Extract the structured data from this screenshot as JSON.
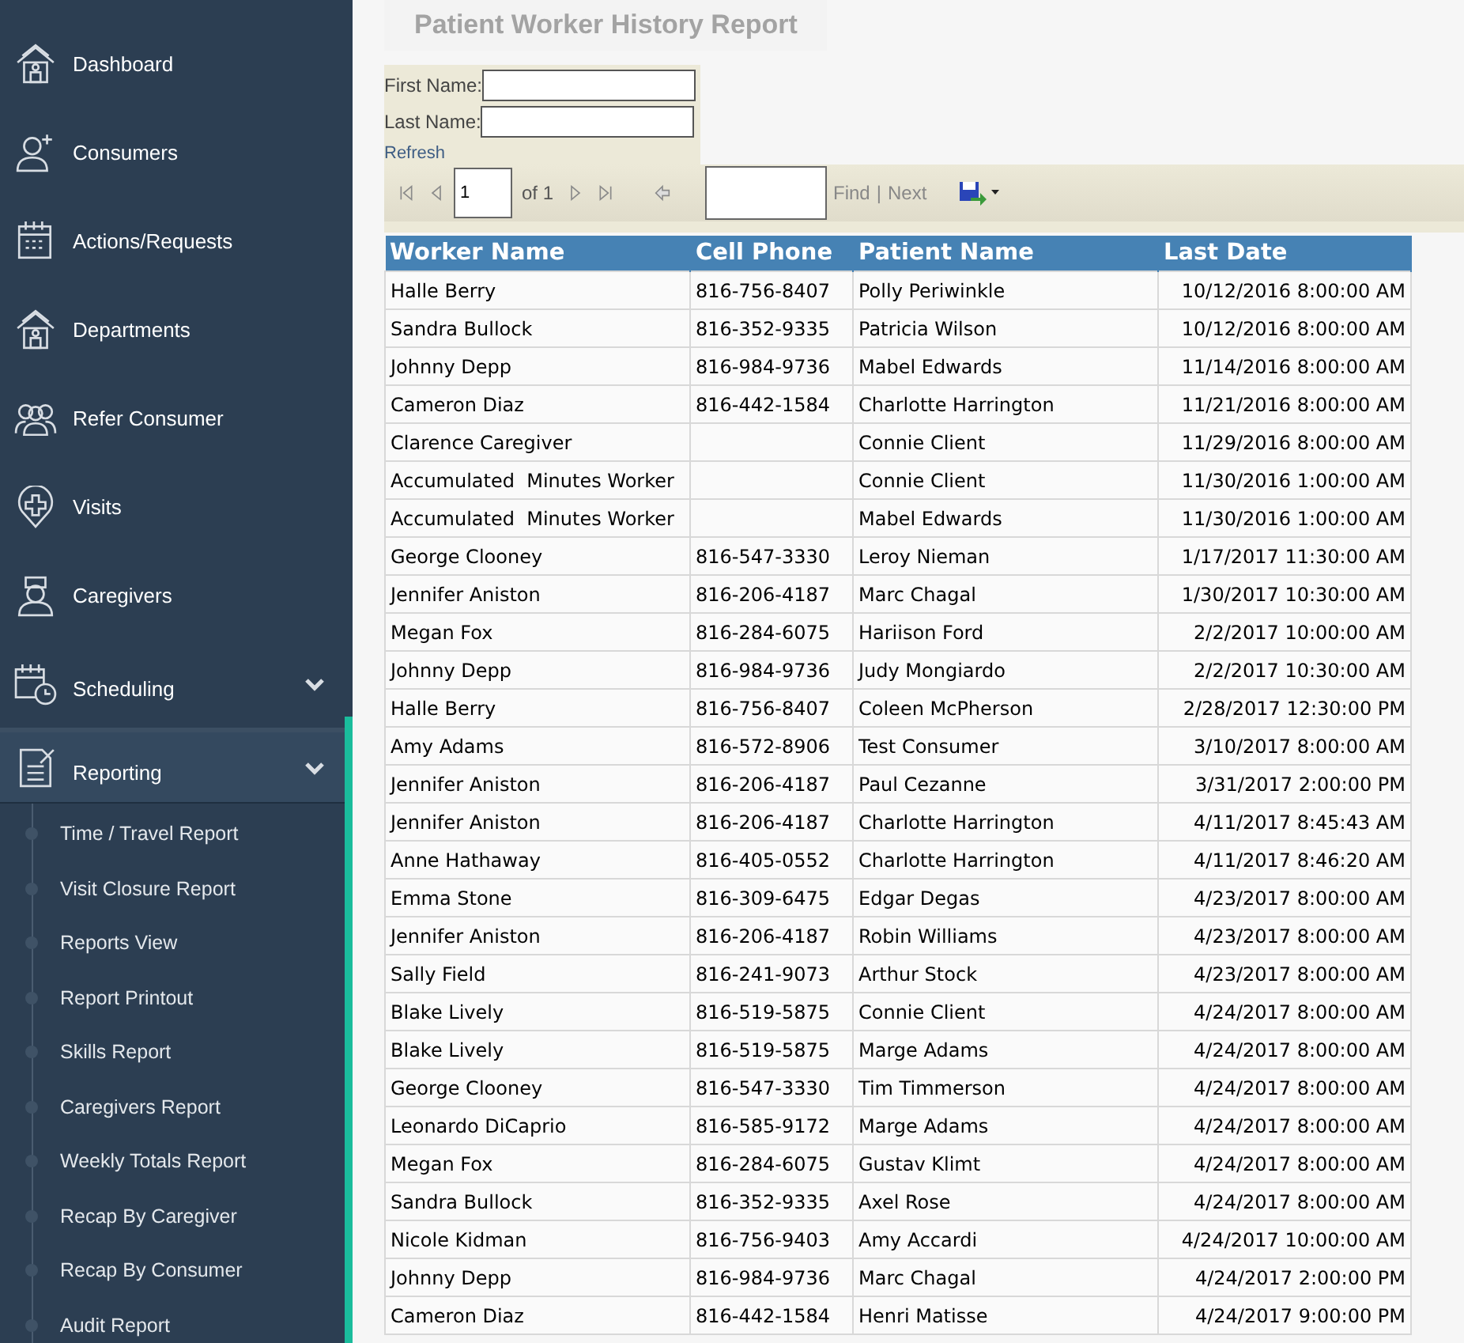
{
  "sidebar": {
    "items": [
      {
        "label": "Dashboard",
        "kind": "link"
      },
      {
        "label": "Consumers",
        "kind": "link"
      },
      {
        "label": "Actions/Requests",
        "kind": "link"
      },
      {
        "label": "Departments",
        "kind": "link"
      },
      {
        "label": "Refer Consumer",
        "kind": "link"
      },
      {
        "label": "Visits",
        "kind": "link"
      },
      {
        "label": "Caregivers",
        "kind": "link"
      },
      {
        "label": "Scheduling",
        "kind": "group",
        "expanded": false
      },
      {
        "label": "Reporting",
        "kind": "group",
        "expanded": true,
        "children": [
          {
            "label": "Time / Travel Report"
          },
          {
            "label": "Visit Closure Report"
          },
          {
            "label": "Reports View"
          },
          {
            "label": "Report Printout"
          },
          {
            "label": "Skills Report"
          },
          {
            "label": "Caregivers Report"
          },
          {
            "label": "Weekly Totals Report"
          },
          {
            "label": "Recap By Caregiver"
          },
          {
            "label": "Recap By Consumer"
          },
          {
            "label": "Audit Report"
          }
        ]
      }
    ]
  },
  "report": {
    "title": "Patient Worker History Report",
    "parameters": [
      {
        "label": "First Name:"
      },
      {
        "label": "Last Name:"
      }
    ],
    "refresh": "Refresh",
    "toolbar": {
      "page": "1",
      "of": "of 1",
      "find": "Find",
      "separator": "|",
      "next": "Next"
    },
    "table": {
      "columns": [
        "Worker Name",
        "Cell Phone",
        "Patient Name",
        "Last Date"
      ],
      "rows": [
        [
          "Halle Berry",
          "816-756-8407",
          "Polly Periwinkle",
          "10/12/2016 8:00:00 AM"
        ],
        [
          "Sandra Bullock",
          "816-352-9335",
          "Patricia Wilson",
          "10/12/2016 8:00:00 AM"
        ],
        [
          "Johnny Depp",
          "816-984-9736",
          "Mabel Edwards",
          "11/14/2016 8:00:00 AM"
        ],
        [
          "Cameron Diaz",
          "816-442-1584",
          "Charlotte Harrington",
          "11/21/2016 8:00:00 AM"
        ],
        [
          "Clarence Caregiver",
          "",
          "Connie Client",
          "11/29/2016 8:00:00 AM"
        ],
        [
          "Accumulated  Minutes Worker",
          "",
          "Connie Client",
          "11/30/2016 1:00:00 AM"
        ],
        [
          "Accumulated  Minutes Worker",
          "",
          "Mabel Edwards",
          "11/30/2016 1:00:00 AM"
        ],
        [
          "George Clooney",
          "816-547-3330",
          "Leroy Nieman",
          "1/17/2017 11:30:00 AM"
        ],
        [
          "Jennifer Aniston",
          "816-206-4187",
          "Marc Chagal",
          "1/30/2017 10:30:00 AM"
        ],
        [
          "Megan Fox",
          "816-284-6075",
          "Hariison Ford",
          "2/2/2017 10:00:00 AM"
        ],
        [
          "Johnny Depp",
          "816-984-9736",
          "Judy Mongiardo",
          "2/2/2017 10:30:00 AM"
        ],
        [
          "Halle Berry",
          "816-756-8407",
          "Coleen McPherson",
          "2/28/2017 12:30:00 PM"
        ],
        [
          "Amy Adams",
          "816-572-8906",
          "Test Consumer",
          "3/10/2017 8:00:00 AM"
        ],
        [
          "Jennifer Aniston",
          "816-206-4187",
          "Paul Cezanne",
          "3/31/2017 2:00:00 PM"
        ],
        [
          "Jennifer Aniston",
          "816-206-4187",
          "Charlotte Harrington",
          "4/11/2017 8:45:43 AM"
        ],
        [
          "Anne Hathaway",
          "816-405-0552",
          "Charlotte Harrington",
          "4/11/2017 8:46:20 AM"
        ],
        [
          "Emma Stone",
          "816-309-6475",
          "Edgar Degas",
          "4/23/2017 8:00:00 AM"
        ],
        [
          "Jennifer Aniston",
          "816-206-4187",
          "Robin Williams",
          "4/23/2017 8:00:00 AM"
        ],
        [
          "Sally Field",
          "816-241-9073",
          "Arthur Stock",
          "4/23/2017 8:00:00 AM"
        ],
        [
          "Blake Lively",
          "816-519-5875",
          "Connie Client",
          "4/24/2017 8:00:00 AM"
        ],
        [
          "Blake Lively",
          "816-519-5875",
          "Marge Adams",
          "4/24/2017 8:00:00 AM"
        ],
        [
          "George Clooney",
          "816-547-3330",
          "Tim Timmerson",
          "4/24/2017 8:00:00 AM"
        ],
        [
          "Leonardo DiCaprio",
          "816-585-9172",
          "Marge Adams",
          "4/24/2017 8:00:00 AM"
        ],
        [
          "Megan Fox",
          "816-284-6075",
          "Gustav Klimt",
          "4/24/2017 8:00:00 AM"
        ],
        [
          "Sandra Bullock",
          "816-352-9335",
          "Axel Rose",
          "4/24/2017 8:00:00 AM"
        ],
        [
          "Nicole Kidman",
          "816-756-9403",
          "Amy Accardi",
          "4/24/2017 10:00:00 AM"
        ],
        [
          "Johnny Depp",
          "816-984-9736",
          "Marc Chagal",
          "4/24/2017 2:00:00 PM"
        ],
        [
          "Cameron Diaz",
          "816-442-1584",
          "Henri Matisse",
          "4/24/2017 9:00:00 PM"
        ]
      ]
    }
  }
}
